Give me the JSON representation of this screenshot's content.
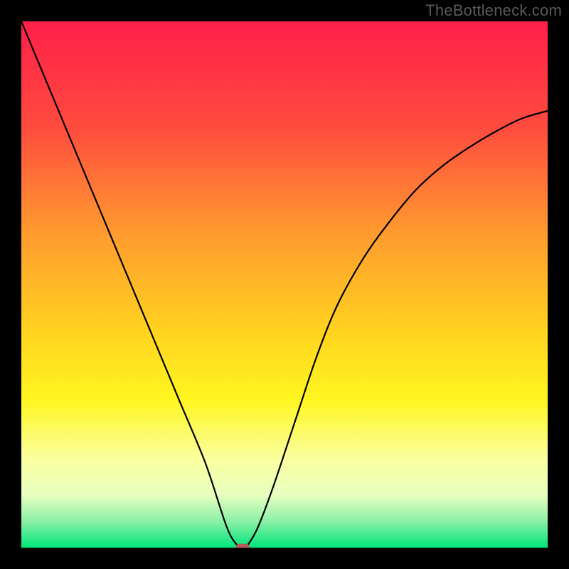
{
  "watermark": "TheBottleneck.com",
  "chart_data": {
    "type": "line",
    "title": "",
    "xlabel": "",
    "ylabel": "",
    "xlim": [
      0,
      100
    ],
    "ylim": [
      0,
      100
    ],
    "gradient_stops": [
      {
        "offset": 0,
        "color": "#ff1f4a"
      },
      {
        "offset": 20,
        "color": "#ff4b3e"
      },
      {
        "offset": 40,
        "color": "#ff9a2f"
      },
      {
        "offset": 60,
        "color": "#ffd61f"
      },
      {
        "offset": 72,
        "color": "#fff621"
      },
      {
        "offset": 83,
        "color": "#fbff9f"
      },
      {
        "offset": 90,
        "color": "#e7ffbf"
      },
      {
        "offset": 95,
        "color": "#8cf0a6"
      },
      {
        "offset": 100,
        "color": "#00e67a"
      }
    ],
    "series": [
      {
        "name": "curve",
        "x": [
          0,
          5,
          10,
          15,
          20,
          25,
          30,
          35,
          39,
          41,
          42,
          43,
          45,
          48,
          52,
          56,
          60,
          65,
          70,
          75,
          80,
          85,
          90,
          95,
          100
        ],
        "y": [
          100,
          88,
          76,
          64,
          52,
          40,
          28,
          16,
          4,
          0.5,
          0,
          0.5,
          4,
          12,
          24,
          36,
          46,
          55,
          62,
          68,
          72.5,
          76,
          79,
          81.5,
          83
        ]
      }
    ],
    "min_point": {
      "x": 42,
      "y": 0
    },
    "marker": {
      "color": "#b85a5a"
    }
  }
}
